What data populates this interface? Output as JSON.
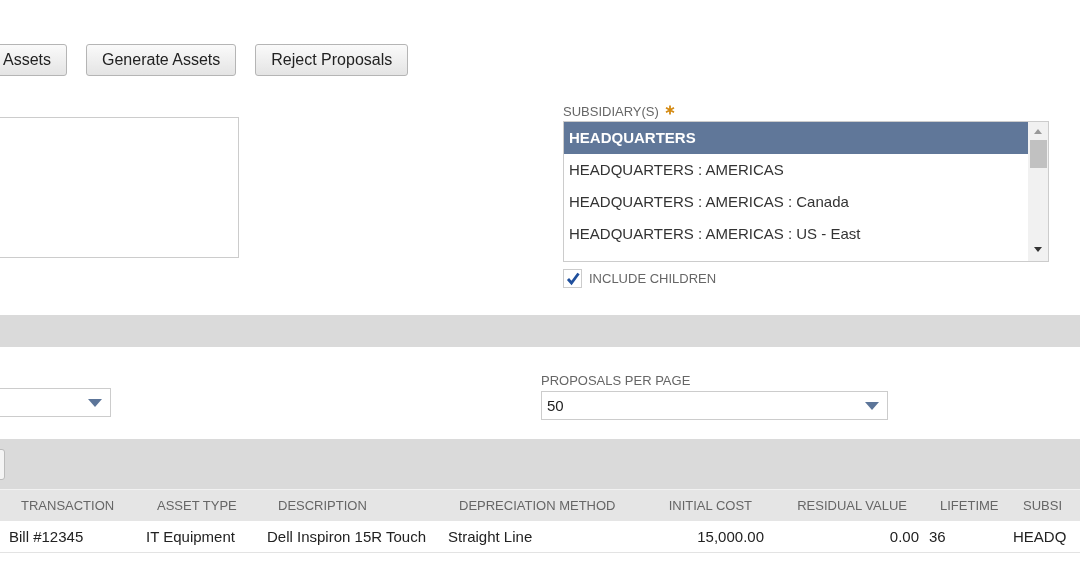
{
  "buttons": [
    {
      "label": "Assets"
    },
    {
      "label": "Generate Assets"
    },
    {
      "label": "Reject Proposals"
    }
  ],
  "subsidiaries": {
    "label": "SUBSIDIARY(S)",
    "required": true,
    "items": [
      {
        "label": "HEADQUARTERS",
        "selected": true
      },
      {
        "label": "HEADQUARTERS : AMERICAS",
        "selected": false
      },
      {
        "label": "HEADQUARTERS : AMERICAS : Canada",
        "selected": false
      },
      {
        "label": "HEADQUARTERS : AMERICAS : US - East",
        "selected": false
      }
    ]
  },
  "include_children": {
    "label": "INCLUDE CHILDREN",
    "checked": true
  },
  "proposals_per_page": {
    "label": "PROPOSALS PER PAGE",
    "value": "50"
  },
  "table": {
    "columns": [
      {
        "label": "TRANSACTION",
        "kind": "text"
      },
      {
        "label": "ASSET TYPE",
        "kind": "text"
      },
      {
        "label": "DESCRIPTION",
        "kind": "text"
      },
      {
        "label": "DEPRECIATION METHOD",
        "kind": "text"
      },
      {
        "label": "INITIAL COST",
        "kind": "amount"
      },
      {
        "label": "RESIDUAL VALUE",
        "kind": "amount"
      },
      {
        "label": "LIFETIME",
        "kind": "text"
      },
      {
        "label": "SUBSI",
        "kind": "text"
      }
    ],
    "rows": [
      {
        "cells": [
          "Bill #12345",
          "IT Equipment",
          "Dell Inspiron 15R Touch",
          "Straight Line",
          "15,000.00",
          "0.00",
          "36",
          "HEADQ"
        ]
      }
    ]
  }
}
